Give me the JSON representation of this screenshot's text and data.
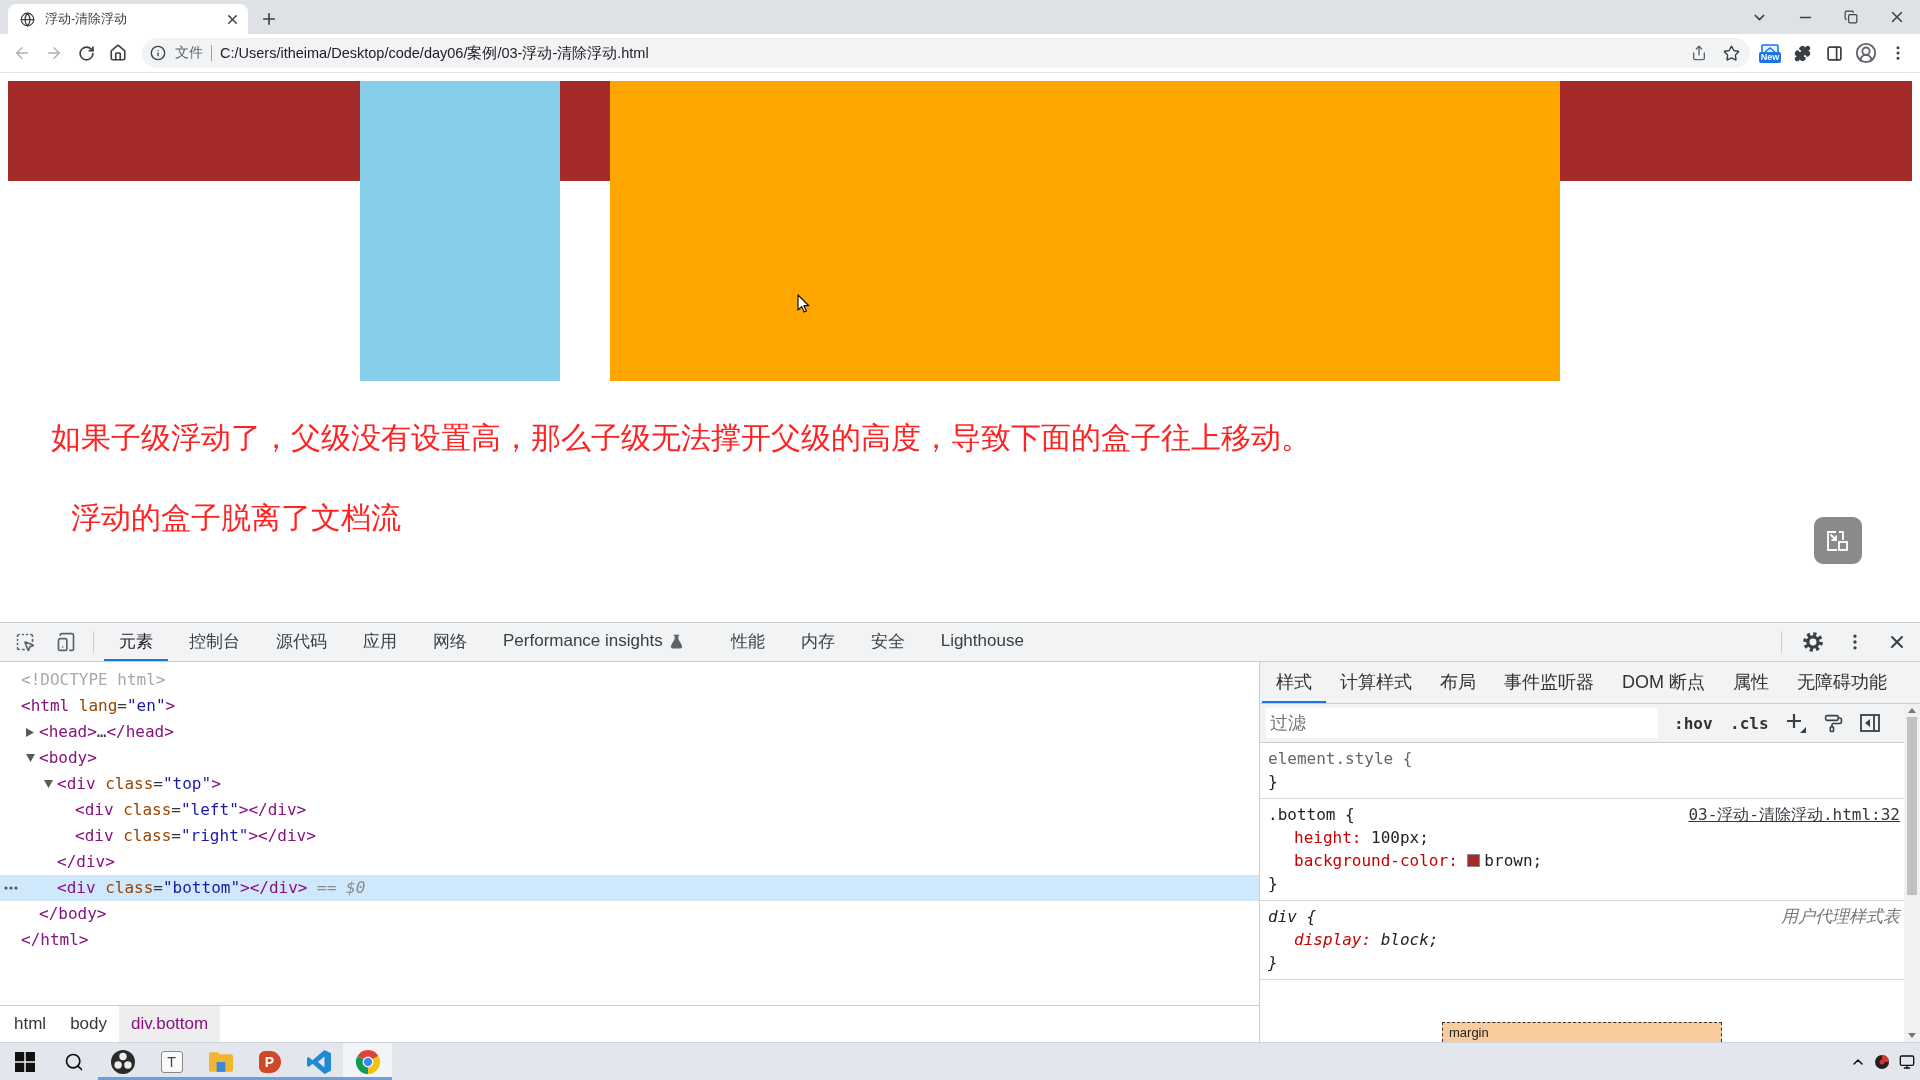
{
  "browser": {
    "tab_title": "浮动-清除浮动",
    "scheme_label": "文件",
    "url": "C:/Users/itheima/Desktop/code/day06/案例/03-浮动-清除浮动.html",
    "extension_badge": "New"
  },
  "page": {
    "blocks": [
      {
        "kind": "bar",
        "color": "#a52a2a"
      },
      {
        "kind": "float-left",
        "color": "#87ceeb"
      },
      {
        "kind": "float-right",
        "color": "#ffa500"
      }
    ],
    "paragraphs": [
      "如果子级浮动了，父级没有设置高，那么子级无法撑开父级的高度，导致下面的盒子往上移动。",
      "浮动的盒子脱离了文档流"
    ]
  },
  "devtools": {
    "tabs": [
      {
        "label": "元素",
        "selected": true,
        "experimental": false
      },
      {
        "label": "控制台",
        "selected": false,
        "experimental": false
      },
      {
        "label": "源代码",
        "selected": false,
        "experimental": false
      },
      {
        "label": "应用",
        "selected": false,
        "experimental": false
      },
      {
        "label": "网络",
        "selected": false,
        "experimental": false
      },
      {
        "label": "Performance insights",
        "selected": false,
        "experimental": true
      },
      {
        "label": "性能",
        "selected": false,
        "experimental": false
      },
      {
        "label": "内存",
        "selected": false,
        "experimental": false
      },
      {
        "label": "安全",
        "selected": false,
        "experimental": false
      },
      {
        "label": "Lighthouse",
        "selected": false,
        "experimental": false
      }
    ],
    "nodes": [
      {
        "tokens": [
          {
            "kind": "doctype",
            "text": "<!DOCTYPE html>"
          }
        ],
        "selected": false
      },
      {
        "tokens": [
          {
            "kind": "tag",
            "text": "<html"
          },
          {
            "kind": "attr",
            "text": " lang"
          },
          {
            "kind": "plain",
            "text": "="
          },
          {
            "kind": "value",
            "text": "\"en\""
          },
          {
            "kind": "tag",
            "text": ">"
          }
        ],
        "selected": false,
        "children": [
          {
            "tokens": [
              {
                "kind": "tag",
                "text": "<head>"
              },
              {
                "kind": "plain",
                "text": "…"
              },
              {
                "kind": "tag",
                "text": "</head>"
              }
            ],
            "expanded": false,
            "selected": false
          },
          {
            "tokens": [
              {
                "kind": "tag",
                "text": "<body>"
              }
            ],
            "expanded": true,
            "selected": false,
            "children": [
              {
                "tokens": [
                  {
                    "kind": "tag",
                    "text": "<div"
                  },
                  {
                    "kind": "attr",
                    "text": " class"
                  },
                  {
                    "kind": "plain",
                    "text": "="
                  },
                  {
                    "kind": "value",
                    "text": "\"top\""
                  },
                  {
                    "kind": "tag",
                    "text": ">"
                  }
                ],
                "expanded": true,
                "selected": false,
                "children": [
                  {
                    "tokens": [
                      {
                        "kind": "tag",
                        "text": "<div"
                      },
                      {
                        "kind": "attr",
                        "text": " class"
                      },
                      {
                        "kind": "plain",
                        "text": "="
                      },
                      {
                        "kind": "value",
                        "text": "\"left\""
                      },
                      {
                        "kind": "tag",
                        "text": "></div>"
                      }
                    ],
                    "selected": false
                  },
                  {
                    "tokens": [
                      {
                        "kind": "tag",
                        "text": "<div"
                      },
                      {
                        "kind": "attr",
                        "text": " class"
                      },
                      {
                        "kind": "plain",
                        "text": "="
                      },
                      {
                        "kind": "value",
                        "text": "\"right\""
                      },
                      {
                        "kind": "tag",
                        "text": "></div>"
                      }
                    ],
                    "selected": false
                  }
                ],
                "end": [
                  {
                    "kind": "tag",
                    "text": "</div>"
                  }
                ]
              },
              {
                "tokens": [
                  {
                    "kind": "tag",
                    "text": "<div"
                  },
                  {
                    "kind": "attr",
                    "text": " class"
                  },
                  {
                    "kind": "plain",
                    "text": "="
                  },
                  {
                    "kind": "value",
                    "text": "\"bottom\""
                  },
                  {
                    "kind": "tag",
                    "text": "></div>"
                  },
                  {
                    "kind": "hint",
                    "text": " == $0"
                  }
                ],
                "selected": true
              }
            ],
            "end": [
              {
                "kind": "tag",
                "text": "</body>"
              }
            ]
          }
        ],
        "end": [
          {
            "kind": "tag",
            "text": "</html>"
          }
        ]
      }
    ],
    "breadcrumbs": [
      {
        "label": "html",
        "selected": false
      },
      {
        "label": "body",
        "selected": false
      },
      {
        "label": "div.bottom",
        "selected": true
      }
    ],
    "side_tabs": [
      {
        "label": "样式",
        "selected": true
      },
      {
        "label": "计算样式",
        "selected": false
      },
      {
        "label": "布局",
        "selected": false
      },
      {
        "label": "事件监听器",
        "selected": false
      },
      {
        "label": "DOM 断点",
        "selected": false
      },
      {
        "label": "属性",
        "selected": false
      },
      {
        "label": "无障碍功能",
        "selected": false
      }
    ],
    "filter": {
      "placeholder": "过滤"
    },
    "filter_buttons": [
      ":hov",
      ".cls"
    ],
    "rules": [
      {
        "kind": "inline",
        "selector": "element.style",
        "open": "{",
        "close": "}"
      },
      {
        "kind": "author",
        "selector": ".bottom",
        "open": "{",
        "close": "}",
        "source": "03-浮动-清除浮动.html:32",
        "declarations": [
          {
            "property": "height",
            "colon": ":",
            "value": "100px;"
          },
          {
            "property": "background-color",
            "colon": ":",
            "color": "#a52a2a",
            "value": "brown;"
          }
        ]
      },
      {
        "kind": "user-agent",
        "selector": "div",
        "open": "{",
        "close": "}",
        "source": "用户代理样式表",
        "declarations": [
          {
            "property": "display",
            "colon": ":",
            "value": "block;"
          }
        ]
      }
    ],
    "box_model": {
      "label": "margin"
    }
  },
  "taskbar": {
    "items": [
      {
        "kind": "start",
        "running": false,
        "active": false
      },
      {
        "kind": "search",
        "running": false,
        "active": false
      },
      {
        "kind": "aperture",
        "running": true,
        "active": false
      },
      {
        "kind": "letter-tile",
        "letter": "T",
        "running": true,
        "active": false
      },
      {
        "kind": "folder",
        "running": true,
        "active": false
      },
      {
        "kind": "slides",
        "letter": "P",
        "running": true,
        "active": false
      },
      {
        "kind": "code-editor",
        "running": true,
        "active": false
      },
      {
        "kind": "browser",
        "running": true,
        "active": true
      }
    ]
  }
}
